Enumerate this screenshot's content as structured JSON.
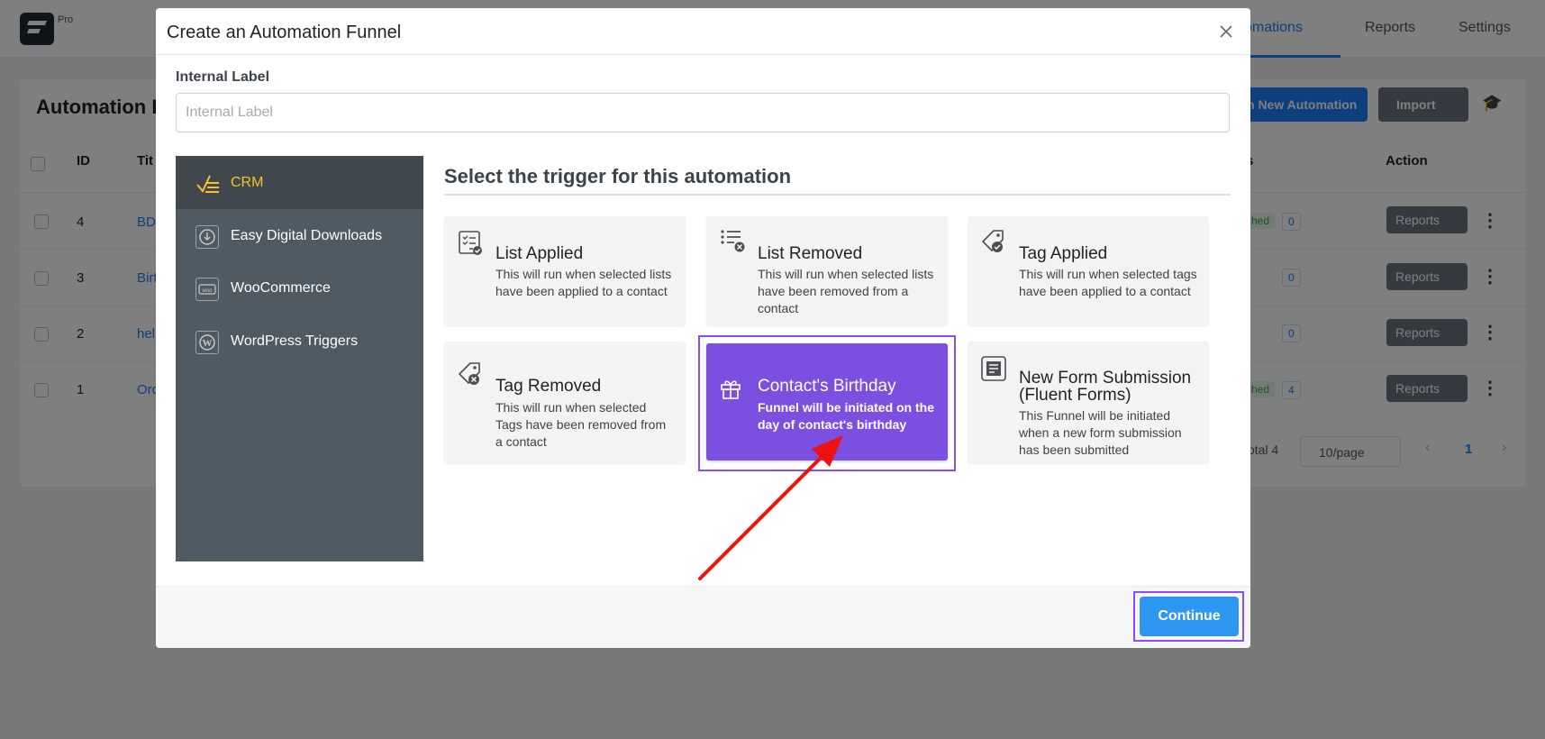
{
  "app": {
    "logo_badge": "Pro",
    "nav": [
      {
        "label": "Automations"
      },
      {
        "label": "Reports"
      },
      {
        "label": "Settings"
      }
    ],
    "page_title": "Automation F",
    "new_button": "n New Automation",
    "import_button": "Import",
    "table": {
      "headers": {
        "id": "ID",
        "title": "Tit",
        "status": "s",
        "action": "Action"
      },
      "rows": [
        {
          "id": "4",
          "title": "BD",
          "status": "hed",
          "subscribers": "0"
        },
        {
          "id": "3",
          "title": "Birt",
          "status": "",
          "subscribers": "0"
        },
        {
          "id": "2",
          "title": "hel",
          "status": "",
          "subscribers": "0"
        },
        {
          "id": "1",
          "title": "Ord",
          "status": "hed",
          "subscribers": "4"
        }
      ],
      "reports_label": "Reports"
    },
    "pagination": {
      "total": "Total 4",
      "page_size": "10/page",
      "current_page": "1"
    }
  },
  "modal": {
    "title": "Create an Automation Funnel",
    "internal_label": {
      "label": "Internal Label",
      "placeholder": "Internal Label",
      "value": ""
    },
    "sidebar": [
      {
        "label": "CRM",
        "icon": "crm-icon",
        "active": true
      },
      {
        "label": "Easy Digital Downloads",
        "icon": "edd-icon",
        "active": false
      },
      {
        "label": "WooCommerce",
        "icon": "woocommerce-icon",
        "active": false
      },
      {
        "label": "WordPress Triggers",
        "icon": "wordpress-icon",
        "active": false
      }
    ],
    "heading": "Select the trigger for this automation",
    "triggers": [
      {
        "title": "List Applied",
        "description": "This will run when selected lists have been applied to a contact",
        "icon": "list-check-icon"
      },
      {
        "title": "List Removed",
        "description": "This will run when selected lists have been removed from a contact",
        "icon": "list-remove-icon"
      },
      {
        "title": "Tag Applied",
        "description": "This will run when selected tags have been applied to a contact",
        "icon": "tag-check-icon"
      },
      {
        "title": "Tag Removed",
        "description": "This will run when selected Tags have been removed from a contact",
        "icon": "tag-remove-icon"
      },
      {
        "title": "Contact's Birthday",
        "description": "Funnel will be initiated on the day of contact's birthday",
        "icon": "gift-icon",
        "selected": true
      },
      {
        "title": "New Form Submission (Fluent Forms)",
        "description": "This Funnel will be initiated when a new form submission has been submitted",
        "icon": "form-icon"
      }
    ],
    "continue_button": "Continue"
  },
  "colors": {
    "selected_card": "#7b4fe0",
    "highlight_border": "#8e4bf3",
    "continue_button": "#2d97f2",
    "sidebar_bg": "#4f5a62",
    "active_accent": "#f7c12e",
    "arrow": "#ee1111"
  }
}
